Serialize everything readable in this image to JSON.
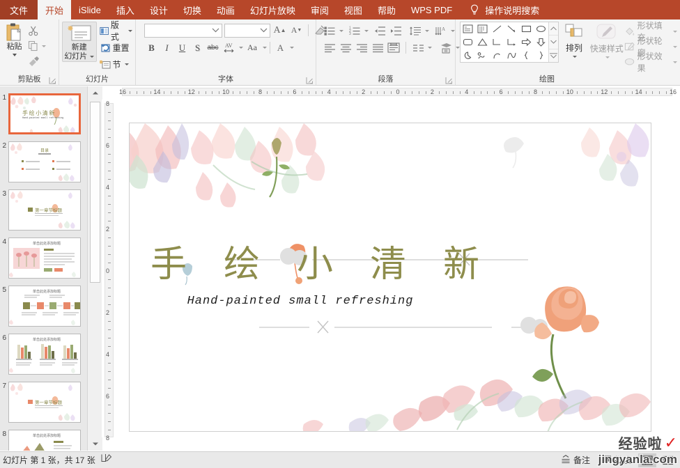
{
  "app": {
    "accent_color": "#b7472a",
    "title_accent": "#8e8d4c"
  },
  "menubar": {
    "items": [
      {
        "label": "文件",
        "state": "file"
      },
      {
        "label": "开始",
        "state": "active"
      },
      {
        "label": "iSlide",
        "state": "normal"
      },
      {
        "label": "插入",
        "state": "normal"
      },
      {
        "label": "设计",
        "state": "normal"
      },
      {
        "label": "切换",
        "state": "normal"
      },
      {
        "label": "动画",
        "state": "normal"
      },
      {
        "label": "幻灯片放映",
        "state": "normal"
      },
      {
        "label": "审阅",
        "state": "normal"
      },
      {
        "label": "视图",
        "state": "normal"
      },
      {
        "label": "帮助",
        "state": "normal"
      },
      {
        "label": "WPS PDF",
        "state": "normal"
      }
    ],
    "search_placeholder": "操作说明搜索",
    "bulb_icon": "lightbulb-icon"
  },
  "ribbon": {
    "groups": [
      {
        "name": "clipboard",
        "label": "剪贴板",
        "paste_label": "粘贴",
        "buttons": [
          "剪切",
          "复制",
          "格式刷"
        ]
      },
      {
        "name": "slides",
        "label": "幻灯片",
        "new_slide_line1": "新建",
        "new_slide_line2": "幻灯片",
        "layout_label": "版式",
        "reset_label": "重置",
        "section_label": "节"
      },
      {
        "name": "font",
        "label": "字体",
        "font_name_value": "",
        "font_name_placeholder": "",
        "font_size_value": "",
        "font_size_placeholder": "",
        "buttons": [
          "B",
          "I",
          "U",
          "S",
          "abc",
          "AV",
          "Aa",
          "A"
        ]
      },
      {
        "name": "paragraph",
        "label": "段落"
      },
      {
        "name": "drawing",
        "label": "绘图",
        "arrange_label": "排列",
        "quickstyle_label": "快速样式",
        "shape_fill_label": "形状填充",
        "shape_outline_label": "形状轮廓",
        "shape_effect_label": "形状效果"
      }
    ]
  },
  "thumbnails": {
    "selected_index": 1,
    "items": [
      {
        "number": "1",
        "kind": "title",
        "title": "手绘小清新",
        "subtitle": "Hand-painted small refreshing"
      },
      {
        "number": "2",
        "kind": "toc",
        "title": "目录"
      },
      {
        "number": "3",
        "kind": "section",
        "title": "第一章节标题"
      },
      {
        "number": "4",
        "kind": "image-text",
        "title": "单击此处添加标题"
      },
      {
        "number": "5",
        "kind": "process",
        "title": "单击此处添加标题"
      },
      {
        "number": "6",
        "kind": "chart",
        "title": "单击此处添加标题"
      },
      {
        "number": "7",
        "kind": "section",
        "title": "第一章节标题"
      },
      {
        "number": "8",
        "kind": "area-chart",
        "title": "单击此处添加标题"
      }
    ]
  },
  "ruler": {
    "horizontal_ticks": [
      "16",
      "14",
      "12",
      "10",
      "8",
      "6",
      "4",
      "2",
      "0",
      "2",
      "4",
      "6",
      "8",
      "10",
      "12",
      "14",
      "16"
    ],
    "vertical_ticks": [
      "8",
      "6",
      "4",
      "2",
      "0",
      "2",
      "4",
      "6",
      "8"
    ]
  },
  "slide": {
    "title": "手 绘 小 清 新",
    "subtitle": "Hand-painted small refreshing",
    "title_color": "#8e8d4c",
    "background": "#ffffff"
  },
  "statusbar": {
    "slide_count_text": "幻灯片 第 1 张，共 17 张",
    "language_icon": "spell-check-icon",
    "notes_label": "备注",
    "comments_label": "批注",
    "notes_icon": "notes-icon",
    "comments_icon": "comment-bubble-icon",
    "view_normal_icon": "normal-view-icon",
    "view_sorter_icon": "slide-sorter-icon"
  },
  "watermark": {
    "cn_text": "经验啦",
    "check": "✓",
    "url": "jingyanla.com",
    "check_color": "#e02020"
  }
}
